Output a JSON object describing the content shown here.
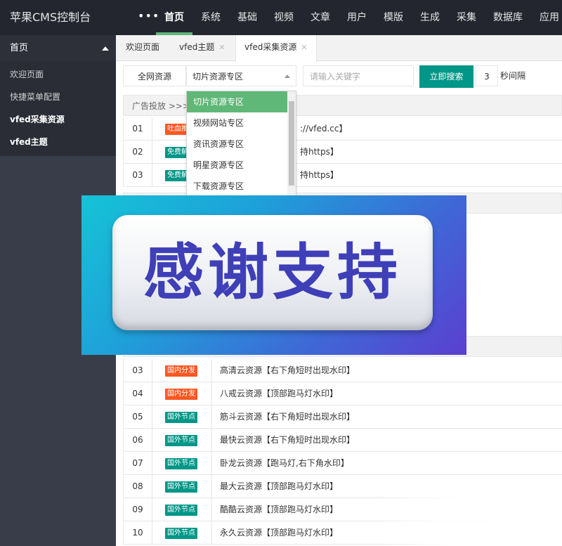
{
  "app": {
    "title": "苹果CMS控制台",
    "more": "•••"
  },
  "topnav": [
    "首页",
    "系统",
    "基础",
    "视频",
    "文章",
    "用户",
    "模版",
    "生成",
    "采集",
    "数据库",
    "应用"
  ],
  "sidebar": {
    "header": "首页",
    "items": [
      "欢迎页面",
      "快捷菜单配置",
      "vfed采集资源",
      "vfed主题"
    ]
  },
  "tabs": [
    {
      "label": "欢迎页面"
    },
    {
      "label": "vfed主题",
      "close": "✕"
    },
    {
      "label": "vfed采集资源",
      "close": "✕"
    }
  ],
  "search": {
    "scope": "全网资源",
    "zone_selected": "切片资源专区",
    "keyword_placeholder": "请输入关键字",
    "button": "立即搜索",
    "interval_value": "3",
    "interval_label": "秒间隔"
  },
  "dropdown": [
    "切片资源专区",
    "视频网站专区",
    "资讯资源专区",
    "明星资源专区",
    "下载资源专区"
  ],
  "section_title": "广告投放 >>> ",
  "top_rows": [
    {
      "num": "01",
      "badge": "吐血推",
      "badge_color": "#ff5722",
      "name": "://vfed.cc】"
    },
    {
      "num": "02",
      "badge": "免费解",
      "badge_color": "#009688",
      "name": "持https】"
    },
    {
      "num": "03",
      "badge": "免费解",
      "badge_color": "#009688",
      "name": "持https】"
    }
  ],
  "rows": [
    {
      "num": "03",
      "badge": "国内分发",
      "badge_color": "#ff5722",
      "name": "高清云资源【右下角短时出现水印】"
    },
    {
      "num": "04",
      "badge": "国内分发",
      "badge_color": "#ff5722",
      "name": "八戒云资源【顶部跑马灯水印】"
    },
    {
      "num": "05",
      "badge": "国外节点",
      "badge_color": "#009688",
      "name": "筋斗云资源【右下角短时出现水印】"
    },
    {
      "num": "06",
      "badge": "国外节点",
      "badge_color": "#009688",
      "name": "最快云资源【右下角短时出现水印】"
    },
    {
      "num": "07",
      "badge": "国外节点",
      "badge_color": "#009688",
      "name": "卧龙云资源【跑马灯,右下角水印】"
    },
    {
      "num": "08",
      "badge": "国外节点",
      "badge_color": "#009688",
      "name": "最大云资源【顶部跑马灯水印】"
    },
    {
      "num": "09",
      "badge": "国外节点",
      "badge_color": "#009688",
      "name": "酷酷云资源【顶部跑马灯水印】"
    },
    {
      "num": "10",
      "badge": "国外节点",
      "badge_color": "#009688",
      "name": "永久云资源【顶部跑马灯水印】"
    }
  ],
  "banner": {
    "text": "感谢支持"
  },
  "colors": {
    "accent": "#009688",
    "nav_active": "#5fb878",
    "hot": "#ff5722",
    "topbar": "#23262e",
    "sidebar": "#393d49"
  }
}
